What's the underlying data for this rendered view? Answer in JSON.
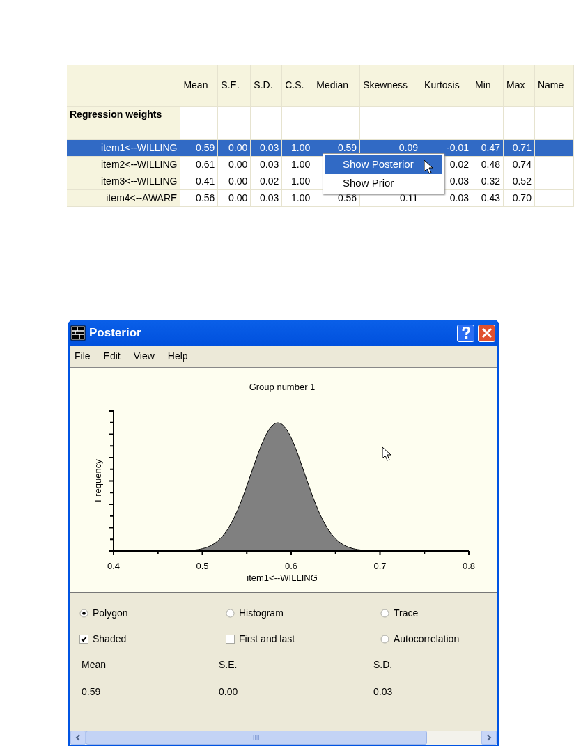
{
  "table": {
    "columns": [
      "Mean",
      "S.E.",
      "S.D.",
      "C.S.",
      "Median",
      "Skewness",
      "Kurtosis",
      "Min",
      "Max",
      "Name"
    ],
    "section": "Regression weights",
    "rows": [
      {
        "label": "item1<--WILLING",
        "selected": true,
        "cells": [
          "0.59",
          "0.00",
          "0.03",
          "1.00",
          "0.59",
          "0.09",
          "-0.01",
          "0.47",
          "0.71"
        ]
      },
      {
        "label": "item2<--WILLING",
        "selected": false,
        "cells": [
          "0.61",
          "0.00",
          "0.03",
          "1.00",
          null,
          null,
          "0.02",
          "0.48",
          "0.74"
        ]
      },
      {
        "label": "item3<--WILLING",
        "selected": false,
        "cells": [
          "0.41",
          "0.00",
          "0.02",
          "1.00",
          null,
          null,
          "0.03",
          "0.32",
          "0.52"
        ]
      },
      {
        "label": "item4<--AWARE",
        "selected": false,
        "cells": [
          "0.56",
          "0.00",
          "0.03",
          "1.00",
          "0.56",
          "0.11",
          "0.03",
          "0.43",
          "0.70"
        ]
      }
    ]
  },
  "context_menu": {
    "items": [
      {
        "label": "Show Posterior",
        "selected": true
      },
      {
        "label": "Show Prior",
        "selected": false
      }
    ]
  },
  "window": {
    "title": "Posterior",
    "menu": [
      "File",
      "Edit",
      "View",
      "Help"
    ],
    "chart": {
      "title": "Group number 1",
      "ylabel": "Frequency",
      "xlabel": "item1<--WILLING",
      "tick_labels": [
        "0.4",
        "0.5",
        "0.6",
        "0.7",
        "0.8"
      ]
    },
    "options": [
      {
        "label": "Polygon",
        "kind": "radio",
        "checked": true
      },
      {
        "label": "Histogram",
        "kind": "radio",
        "checked": false
      },
      {
        "label": "Trace",
        "kind": "radio",
        "checked": false
      },
      {
        "label": "Shaded",
        "kind": "checkbox",
        "checked": true
      },
      {
        "label": "First and last",
        "kind": "checkbox",
        "checked": false
      },
      {
        "label": "Autocorrelation",
        "kind": "radio",
        "checked": false
      }
    ],
    "stats": [
      {
        "label": "Mean",
        "value": "0.59"
      },
      {
        "label": "S.E.",
        "value": "0.00"
      },
      {
        "label": "S.D.",
        "value": "0.03"
      }
    ]
  }
}
